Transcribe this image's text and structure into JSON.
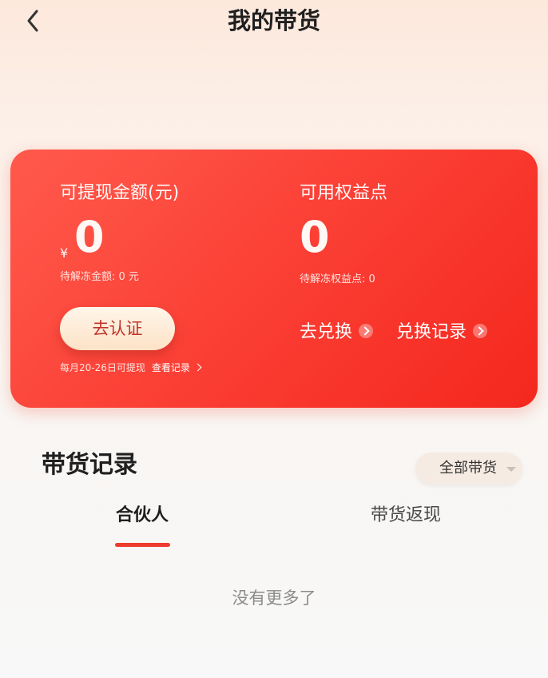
{
  "header": {
    "back_icon": "chevron-left-icon",
    "title": "我的带货"
  },
  "card": {
    "left": {
      "label": "可提现金额(元)",
      "currency_symbol": "¥",
      "amount": "0",
      "pending_note": "待解冻金额: 0 元",
      "verify_button": "去认证",
      "withdraw_note": "每月20-26日可提现",
      "record_link": "查看记录"
    },
    "right": {
      "label": "可用权益点",
      "points": "0",
      "pending_note": "待解冻权益点: 0",
      "exchange_link": "去兑换",
      "exchange_record_link": "兑换记录"
    },
    "colors": {
      "start": "#ff5a4c",
      "end": "#f4271d"
    }
  },
  "records": {
    "title": "带货记录",
    "filter_selected": "全部带货",
    "tabs": [
      {
        "label": "合伙人",
        "active": true
      },
      {
        "label": "带货返现",
        "active": false
      }
    ],
    "empty_text": "没有更多了",
    "accent_color": "#ee3b2f"
  }
}
